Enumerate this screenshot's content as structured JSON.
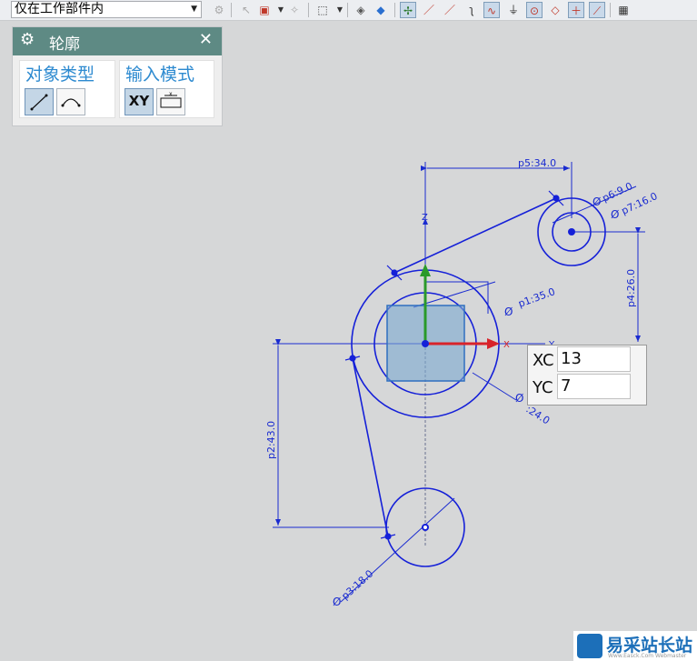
{
  "toolbar": {
    "filter_value": "仅在工作部件内",
    "icons": [
      "snap-icon",
      "select-icon",
      "deselect-icon",
      "box-select-icon",
      "shaded-icon",
      "cube-icon",
      "point-snap-icon",
      "line-icon",
      "line2-icon",
      "curve-icon",
      "wave-icon",
      "tangent-icon",
      "center-icon",
      "circle-point-icon",
      "cross-icon",
      "intersect-icon",
      "grid-icon"
    ]
  },
  "panel": {
    "title": "轮廓",
    "object_type_label": "对象类型",
    "input_mode_label": "输入模式",
    "xy_label": "XY",
    "xy_mode_selected": true,
    "line_option_selected": true
  },
  "drawing": {
    "dims": {
      "p5": "p5:34.0",
      "p6": "p6:9.0",
      "p7": "p7:16.0",
      "p1": "p1:35.0",
      "p4": "p4:26.0",
      "p2": "p2:43.0",
      "p3": "p3:18.0",
      "p_partial": ":24.0"
    },
    "axis_z": "Z",
    "axis_x": "X",
    "axis_y": "Y",
    "colors": {
      "sketch": "#1520d8",
      "dimension": "#1a2bd0",
      "x_axis": "#d8232a",
      "z_axis": "#2a9a2a",
      "y_axis": "#1a2bd0",
      "fill": "#7aa8d0"
    }
  },
  "coords": {
    "xc_label": "XC",
    "xc_value": "13",
    "yc_label": "YC",
    "yc_value": "7"
  },
  "watermark": {
    "text": "易采站长站",
    "sub": "Www.Easck.Com  Webmaster"
  }
}
